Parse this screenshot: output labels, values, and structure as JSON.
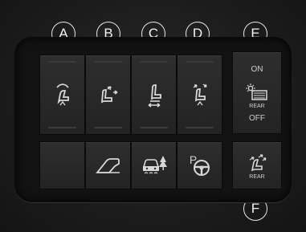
{
  "callouts": {
    "a": "A",
    "b": "B",
    "c": "C",
    "d": "D",
    "e": "E",
    "f": "F"
  },
  "buttons": {
    "seat_lumbar": {
      "icon": "seat-lumbar-icon"
    },
    "seat_back_recline": {
      "icon": "seat-recline-icon"
    },
    "seat_slide": {
      "icon": "seat-slide-icon"
    },
    "seat_tilt": {
      "icon": "seat-tilt-icon"
    },
    "rear_window_defrost": {
      "icon": "rear-defrost-icon",
      "on_label": "ON",
      "off_label": "OFF",
      "rear_label": "REAR"
    },
    "blank": {
      "icon": ""
    },
    "approach_angle": {
      "icon": "hill-descent-icon"
    },
    "traction": {
      "icon": "traction-control-icon"
    },
    "steering_park": {
      "icon": "park-steering-icon",
      "label": "P"
    },
    "rear_seat_adjust": {
      "icon": "rear-seat-adjust-icon",
      "label": "REAR"
    }
  },
  "colors": {
    "icon": "#d8d8d8",
    "panel": "#121212",
    "button": "#2a2a2a",
    "callout": "#e8e8e8"
  }
}
